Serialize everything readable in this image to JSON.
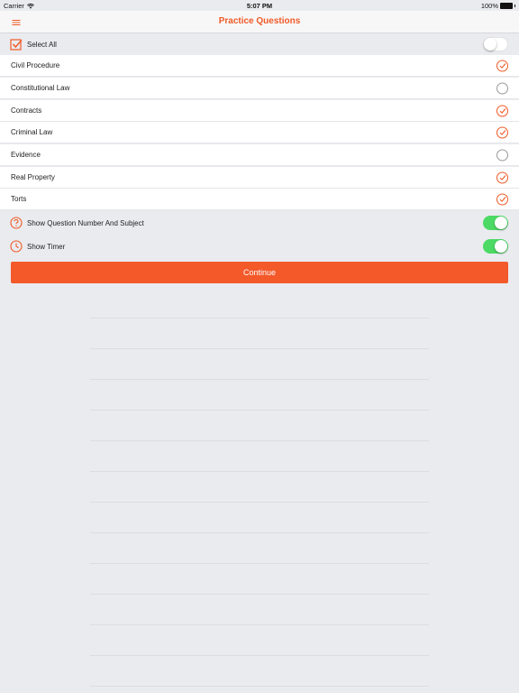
{
  "status_bar": {
    "carrier": "Carrier",
    "time": "5:07 PM",
    "battery": "100%"
  },
  "nav": {
    "title": "Practice Questions",
    "menu_icon": "hamburger-icon"
  },
  "select_all": {
    "label": "Select All",
    "enabled": false
  },
  "subjects": [
    {
      "label": "Civil Procedure",
      "checked": true
    },
    {
      "label": "Constitutional Law",
      "checked": false
    },
    {
      "label": "Contracts",
      "checked": true
    },
    {
      "label": "Criminal Law",
      "checked": true
    },
    {
      "label": "Evidence",
      "checked": false
    },
    {
      "label": "Real Property",
      "checked": true
    },
    {
      "label": "Torts",
      "checked": true
    }
  ],
  "options": {
    "show_question_number": {
      "label": "Show Question Number And Subject",
      "enabled": true,
      "icon": "question-circle-icon"
    },
    "show_timer": {
      "label": "Show Timer",
      "enabled": true,
      "icon": "clock-icon"
    }
  },
  "continue_label": "Continue",
  "colors": {
    "accent": "#f05a28",
    "toggle_on": "#4cd964",
    "background": "#eaebef"
  }
}
